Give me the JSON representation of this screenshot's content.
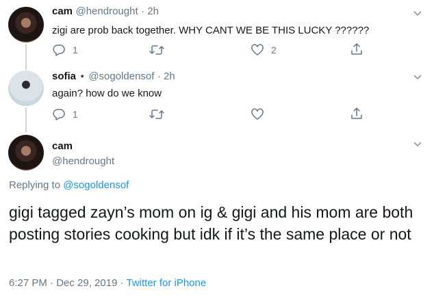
{
  "tweet1": {
    "name": "cam",
    "handle": "@hendrought",
    "time": "· 2h",
    "text": "zigi are prob back together. WHY CANT WE BE THIS LUCKY ??????",
    "reply_count": "1",
    "retweet_count": "",
    "like_count": "2"
  },
  "tweet2": {
    "name": "sofia",
    "star": "⋆",
    "handle": "@sogoldensof",
    "time": "· 2h",
    "text": "again? how do we know",
    "reply_count": "1",
    "retweet_count": "",
    "like_count": ""
  },
  "main_tweet": {
    "name": "cam",
    "handle": "@hendrought",
    "replying_prefix": "Replying to ",
    "replying_to": "@sogoldensof",
    "text": "gigi tagged zayn’s mom on ig & gigi and his mom are both posting stories cooking but idk if it’s the same place or not",
    "timestamp": "6:27 PM · Dec 29, 2019 · ",
    "source": "Twitter for iPhone"
  },
  "icons": [
    "reply-icon",
    "retweet-icon",
    "like-icon",
    "share-icon",
    "chevron-down-icon"
  ],
  "colors": {
    "link": "#1b95e0",
    "muted": "#657786",
    "text": "#14171a",
    "line": "#ccd6dd"
  }
}
